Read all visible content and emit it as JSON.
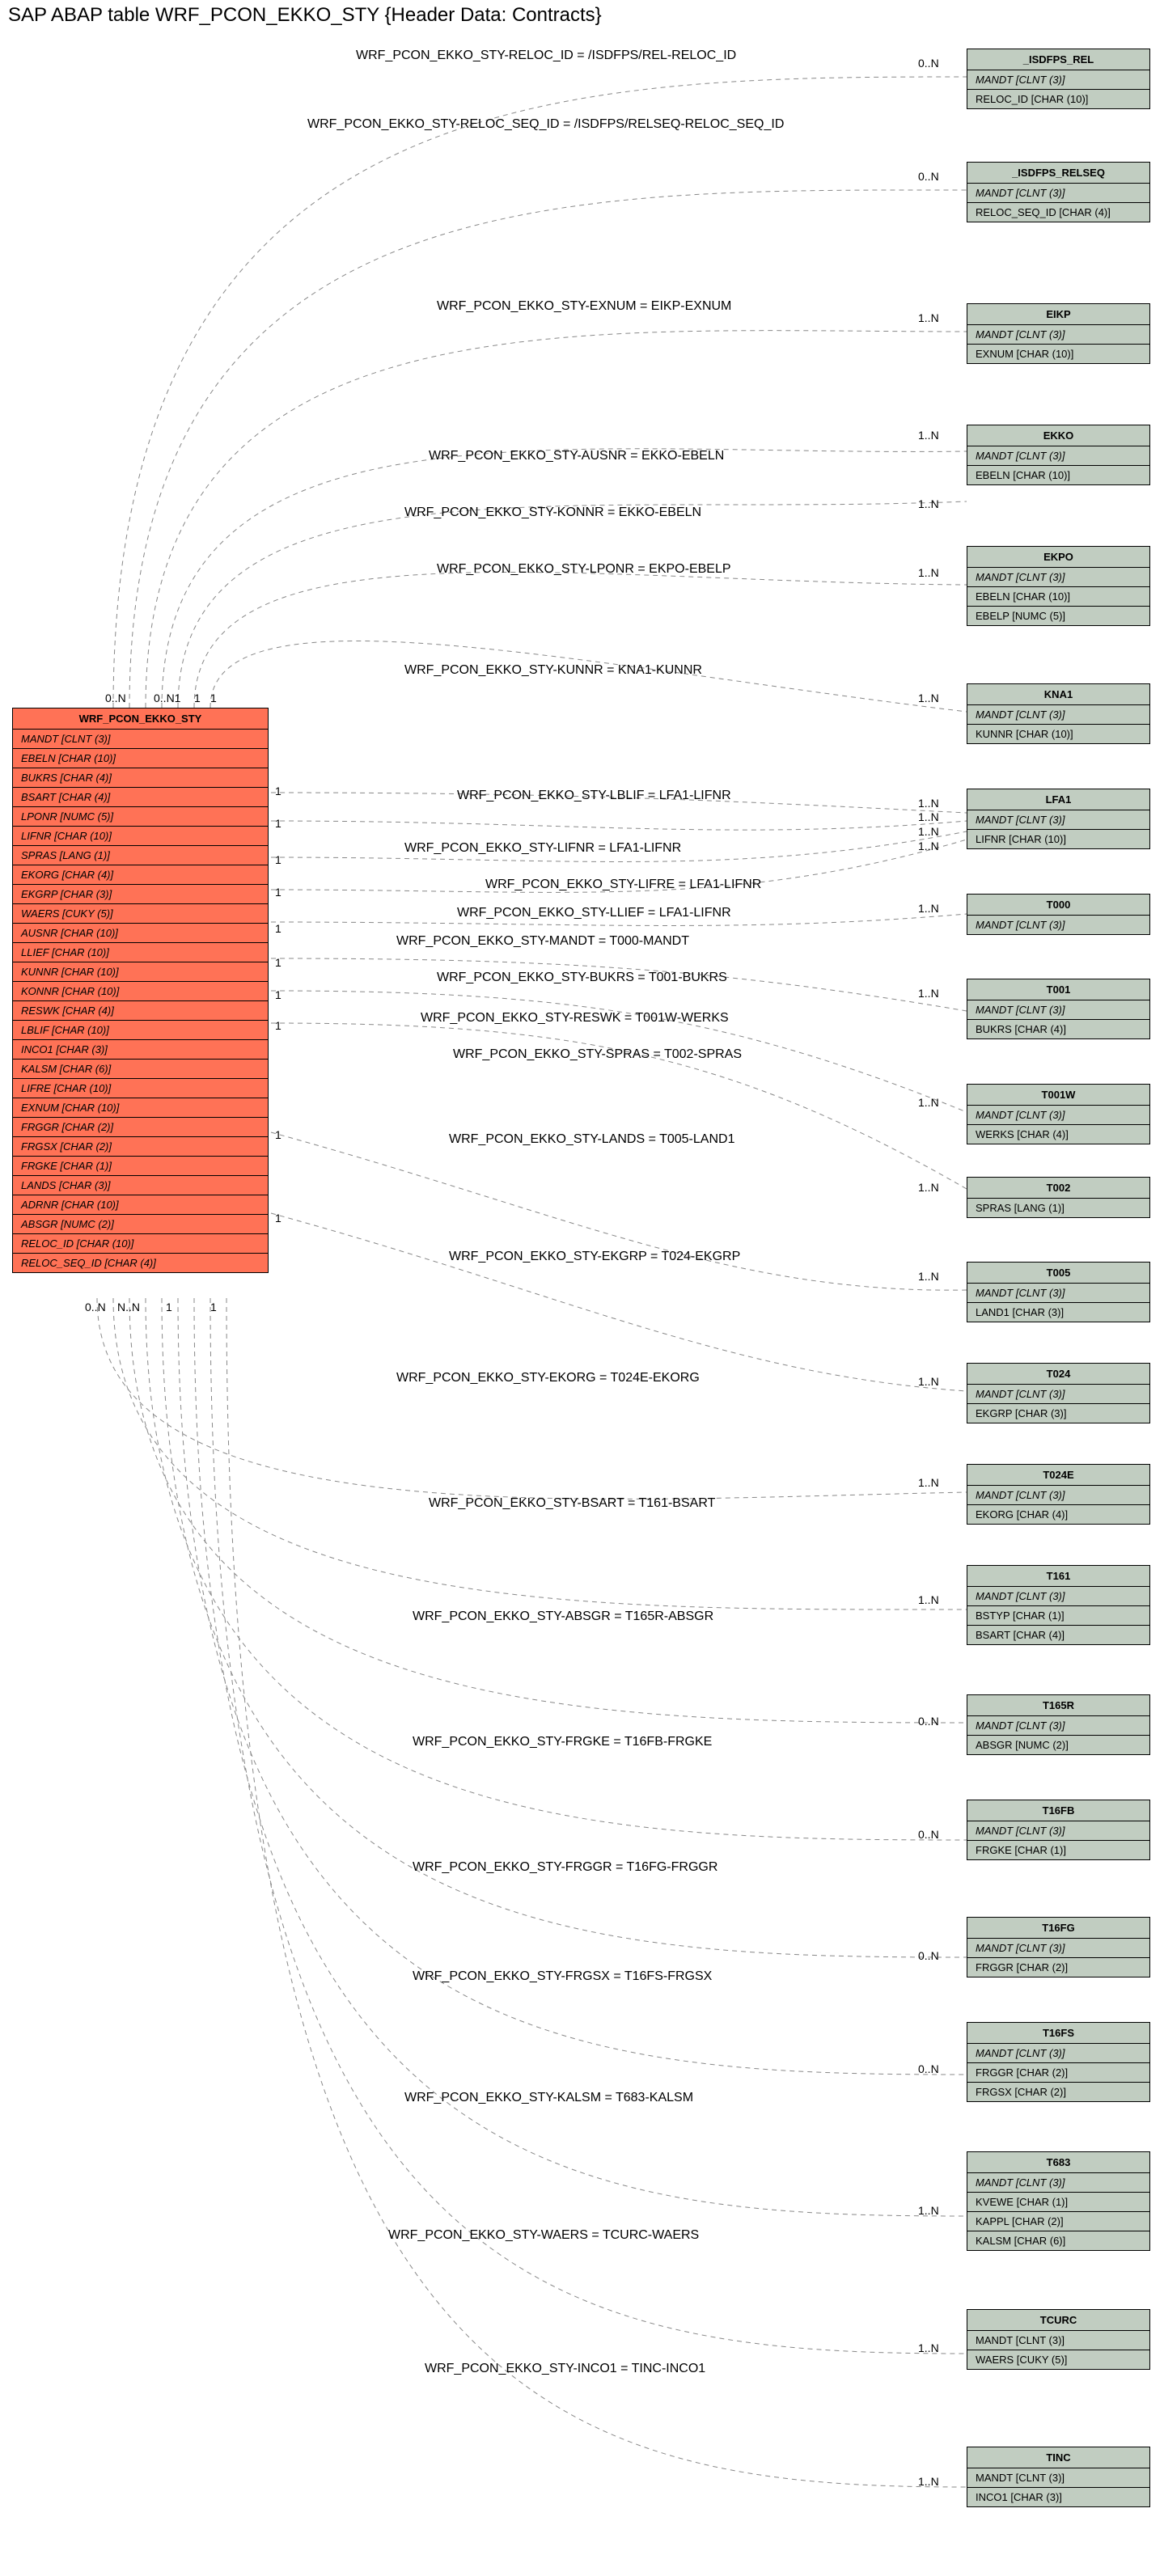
{
  "title": "SAP ABAP table WRF_PCON_EKKO_STY {Header Data: Contracts}",
  "main": {
    "name": "WRF_PCON_EKKO_STY",
    "fields": [
      "MANDT [CLNT (3)]",
      "EBELN [CHAR (10)]",
      "BUKRS [CHAR (4)]",
      "BSART [CHAR (4)]",
      "LPONR [NUMC (5)]",
      "LIFNR [CHAR (10)]",
      "SPRAS [LANG (1)]",
      "EKORG [CHAR (4)]",
      "EKGRP [CHAR (3)]",
      "WAERS [CUKY (5)]",
      "AUSNR [CHAR (10)]",
      "LLIEF [CHAR (10)]",
      "KUNNR [CHAR (10)]",
      "KONNR [CHAR (10)]",
      "RESWK [CHAR (4)]",
      "LBLIF [CHAR (10)]",
      "INCO1 [CHAR (3)]",
      "KALSM [CHAR (6)]",
      "LIFRE [CHAR (10)]",
      "EXNUM [CHAR (10)]",
      "FRGGR [CHAR (2)]",
      "FRGSX [CHAR (2)]",
      "FRGKE [CHAR (1)]",
      "LANDS [CHAR (3)]",
      "ADRNR [CHAR (10)]",
      "ABSGR [NUMC (2)]",
      "RELOC_ID [CHAR (10)]",
      "RELOC_SEQ_ID [CHAR (4)]"
    ]
  },
  "refs": [
    {
      "name": "_ISDFPS_REL",
      "fields": [
        "MANDT [CLNT (3)]",
        "RELOC_ID [CHAR (10)]"
      ],
      "noitalic": [
        1
      ]
    },
    {
      "name": "_ISDFPS_RELSEQ",
      "fields": [
        "MANDT [CLNT (3)]",
        "RELOC_SEQ_ID [CHAR (4)]"
      ],
      "noitalic": [
        1
      ]
    },
    {
      "name": "EIKP",
      "fields": [
        "MANDT [CLNT (3)]",
        "EXNUM [CHAR (10)]"
      ],
      "noitalic": [
        1
      ]
    },
    {
      "name": "EKKO",
      "fields": [
        "MANDT [CLNT (3)]",
        "EBELN [CHAR (10)]"
      ],
      "noitalic": [
        1
      ]
    },
    {
      "name": "EKPO",
      "fields": [
        "MANDT [CLNT (3)]",
        "EBELN [CHAR (10)]",
        "EBELP [NUMC (5)]"
      ],
      "noitalic": [
        1,
        2
      ]
    },
    {
      "name": "KNA1",
      "fields": [
        "MANDT [CLNT (3)]",
        "KUNNR [CHAR (10)]"
      ],
      "noitalic": [
        1
      ]
    },
    {
      "name": "LFA1",
      "fields": [
        "MANDT [CLNT (3)]",
        "LIFNR [CHAR (10)]"
      ],
      "noitalic": [
        1
      ]
    },
    {
      "name": "T000",
      "fields": [
        "MANDT [CLNT (3)]"
      ],
      "noitalic": []
    },
    {
      "name": "T001",
      "fields": [
        "MANDT [CLNT (3)]",
        "BUKRS [CHAR (4)]"
      ],
      "noitalic": [
        1
      ]
    },
    {
      "name": "T001W",
      "fields": [
        "MANDT [CLNT (3)]",
        "WERKS [CHAR (4)]"
      ],
      "noitalic": [
        1
      ]
    },
    {
      "name": "T002",
      "fields": [
        "SPRAS [LANG (1)]"
      ],
      "noitalic": [
        0
      ]
    },
    {
      "name": "T005",
      "fields": [
        "MANDT [CLNT (3)]",
        "LAND1 [CHAR (3)]"
      ],
      "noitalic": [
        1
      ]
    },
    {
      "name": "T024",
      "fields": [
        "MANDT [CLNT (3)]",
        "EKGRP [CHAR (3)]"
      ],
      "noitalic": [
        1
      ]
    },
    {
      "name": "T024E",
      "fields": [
        "MANDT [CLNT (3)]",
        "EKORG [CHAR (4)]"
      ],
      "noitalic": [
        1
      ]
    },
    {
      "name": "T161",
      "fields": [
        "MANDT [CLNT (3)]",
        "BSTYP [CHAR (1)]",
        "BSART [CHAR (4)]"
      ],
      "noitalic": [
        1,
        2
      ]
    },
    {
      "name": "T165R",
      "fields": [
        "MANDT [CLNT (3)]",
        "ABSGR [NUMC (2)]"
      ],
      "noitalic": [
        1
      ]
    },
    {
      "name": "T16FB",
      "fields": [
        "MANDT [CLNT (3)]",
        "FRGKE [CHAR (1)]"
      ],
      "noitalic": [
        1
      ]
    },
    {
      "name": "T16FG",
      "fields": [
        "MANDT [CLNT (3)]",
        "FRGGR [CHAR (2)]"
      ],
      "noitalic": [
        1
      ]
    },
    {
      "name": "T16FS",
      "fields": [
        "MANDT [CLNT (3)]",
        "FRGGR [CHAR (2)]",
        "FRGSX [CHAR (2)]"
      ],
      "noitalic": [
        1,
        2
      ]
    },
    {
      "name": "T683",
      "fields": [
        "MANDT [CLNT (3)]",
        "KVEWE [CHAR (1)]",
        "KAPPL [CHAR (2)]",
        "KALSM [CHAR (6)]"
      ],
      "noitalic": [
        1,
        2,
        3
      ]
    },
    {
      "name": "TCURC",
      "fields": [
        "MANDT [CLNT (3)]",
        "WAERS [CUKY (5)]"
      ],
      "noitalic": [
        0,
        1
      ]
    },
    {
      "name": "TINC",
      "fields": [
        "MANDT [CLNT (3)]",
        "INCO1 [CHAR (3)]"
      ],
      "noitalic": [
        0,
        1
      ]
    }
  ],
  "edges": [
    {
      "label": "WRF_PCON_EKKO_STY-RELOC_ID = /ISDFPS/REL-RELOC_ID",
      "card": "0..N"
    },
    {
      "label": "WRF_PCON_EKKO_STY-RELOC_SEQ_ID = /ISDFPS/RELSEQ-RELOC_SEQ_ID",
      "card": "0..N"
    },
    {
      "label": "WRF_PCON_EKKO_STY-EXNUM = EIKP-EXNUM",
      "card": "1..N"
    },
    {
      "label": "WRF_PCON_EKKO_STY-AUSNR = EKKO-EBELN",
      "card": "1..N"
    },
    {
      "label": "WRF_PCON_EKKO_STY-KONNR = EKKO-EBELN",
      "card": "1..N"
    },
    {
      "label": "WRF_PCON_EKKO_STY-LPONR = EKPO-EBELP",
      "card": "1..N"
    },
    {
      "label": "WRF_PCON_EKKO_STY-KUNNR = KNA1-KUNNR",
      "card": "1..N"
    },
    {
      "label": "WRF_PCON_EKKO_STY-LBLIF = LFA1-LIFNR",
      "card": "1..N"
    },
    {
      "label": "WRF_PCON_EKKO_STY-LIFNR = LFA1-LIFNR",
      "card": "1..N"
    },
    {
      "label": "WRF_PCON_EKKO_STY-LIFRE = LFA1-LIFNR",
      "card": "1..N"
    },
    {
      "label": "WRF_PCON_EKKO_STY-LLIEF = LFA1-LIFNR",
      "card": "1..N"
    },
    {
      "label": "WRF_PCON_EKKO_STY-MANDT = T000-MANDT",
      "card": "1..N"
    },
    {
      "label": "WRF_PCON_EKKO_STY-BUKRS = T001-BUKRS",
      "card": "1..N"
    },
    {
      "label": "WRF_PCON_EKKO_STY-RESWK = T001W-WERKS",
      "card": "1..N"
    },
    {
      "label": "WRF_PCON_EKKO_STY-SPRAS = T002-SPRAS",
      "card": "1..N"
    },
    {
      "label": "WRF_PCON_EKKO_STY-LANDS = T005-LAND1",
      "card": "1..N"
    },
    {
      "label": "WRF_PCON_EKKO_STY-EKGRP = T024-EKGRP",
      "card": "1..N"
    },
    {
      "label": "WRF_PCON_EKKO_STY-EKORG = T024E-EKORG",
      "card": "1..N"
    },
    {
      "label": "WRF_PCON_EKKO_STY-BSART = T161-BSART",
      "card": "1..N"
    },
    {
      "label": "WRF_PCON_EKKO_STY-ABSGR = T165R-ABSGR",
      "card": "0..N"
    },
    {
      "label": "WRF_PCON_EKKO_STY-FRGKE = T16FB-FRGKE",
      "card": "0..N"
    },
    {
      "label": "WRF_PCON_EKKO_STY-FRGGR = T16FG-FRGGR",
      "card": "0..N"
    },
    {
      "label": "WRF_PCON_EKKO_STY-FRGSX = T16FS-FRGSX",
      "card": "0..N"
    },
    {
      "label": "WRF_PCON_EKKO_STY-KALSM = T683-KALSM",
      "card": "1..N"
    },
    {
      "label": "WRF_PCON_EKKO_STY-WAERS = TCURC-WAERS",
      "card": "1..N"
    },
    {
      "label": "WRF_PCON_EKKO_STY-INCO1 = TINC-INCO1",
      "card": "1..N"
    }
  ],
  "left_cards": [
    "0..N",
    "0..N",
    "1",
    "1",
    "1",
    "1",
    "1",
    "1",
    "1",
    "1",
    "1",
    "1",
    "1"
  ],
  "bottom_cards": [
    "0..N",
    "0..N",
    "1",
    "1"
  ],
  "chart_data": {
    "type": "erd",
    "main_table": {
      "name": "WRF_PCON_EKKO_STY",
      "description": "Header Data: Contracts",
      "fields": [
        {
          "name": "MANDT",
          "type": "CLNT",
          "len": 3
        },
        {
          "name": "EBELN",
          "type": "CHAR",
          "len": 10
        },
        {
          "name": "BUKRS",
          "type": "CHAR",
          "len": 4
        },
        {
          "name": "BSART",
          "type": "CHAR",
          "len": 4
        },
        {
          "name": "LPONR",
          "type": "NUMC",
          "len": 5
        },
        {
          "name": "LIFNR",
          "type": "CHAR",
          "len": 10
        },
        {
          "name": "SPRAS",
          "type": "LANG",
          "len": 1
        },
        {
          "name": "EKORG",
          "type": "CHAR",
          "len": 4
        },
        {
          "name": "EKGRP",
          "type": "CHAR",
          "len": 3
        },
        {
          "name": "WAERS",
          "type": "CUKY",
          "len": 5
        },
        {
          "name": "AUSNR",
          "type": "CHAR",
          "len": 10
        },
        {
          "name": "LLIEF",
          "type": "CHAR",
          "len": 10
        },
        {
          "name": "KUNNR",
          "type": "CHAR",
          "len": 10
        },
        {
          "name": "KONNR",
          "type": "CHAR",
          "len": 10
        },
        {
          "name": "RESWK",
          "type": "CHAR",
          "len": 4
        },
        {
          "name": "LBLIF",
          "type": "CHAR",
          "len": 10
        },
        {
          "name": "INCO1",
          "type": "CHAR",
          "len": 3
        },
        {
          "name": "KALSM",
          "type": "CHAR",
          "len": 6
        },
        {
          "name": "LIFRE",
          "type": "CHAR",
          "len": 10
        },
        {
          "name": "EXNUM",
          "type": "CHAR",
          "len": 10
        },
        {
          "name": "FRGGR",
          "type": "CHAR",
          "len": 2
        },
        {
          "name": "FRGSX",
          "type": "CHAR",
          "len": 2
        },
        {
          "name": "FRGKE",
          "type": "CHAR",
          "len": 1
        },
        {
          "name": "LANDS",
          "type": "CHAR",
          "len": 3
        },
        {
          "name": "ADRNR",
          "type": "CHAR",
          "len": 10
        },
        {
          "name": "ABSGR",
          "type": "NUMC",
          "len": 2
        },
        {
          "name": "RELOC_ID",
          "type": "CHAR",
          "len": 10
        },
        {
          "name": "RELOC_SEQ_ID",
          "type": "CHAR",
          "len": 4
        }
      ]
    },
    "relations": [
      {
        "from_field": "RELOC_ID",
        "to_table": "/ISDFPS/REL",
        "to_field": "RELOC_ID",
        "cardinality": "0..N"
      },
      {
        "from_field": "RELOC_SEQ_ID",
        "to_table": "/ISDFPS/RELSEQ",
        "to_field": "RELOC_SEQ_ID",
        "cardinality": "0..N"
      },
      {
        "from_field": "EXNUM",
        "to_table": "EIKP",
        "to_field": "EXNUM",
        "cardinality": "1..N"
      },
      {
        "from_field": "AUSNR",
        "to_table": "EKKO",
        "to_field": "EBELN",
        "cardinality": "1..N"
      },
      {
        "from_field": "KONNR",
        "to_table": "EKKO",
        "to_field": "EBELN",
        "cardinality": "1..N"
      },
      {
        "from_field": "LPONR",
        "to_table": "EKPO",
        "to_field": "EBELP",
        "cardinality": "1..N"
      },
      {
        "from_field": "KUNNR",
        "to_table": "KNA1",
        "to_field": "KUNNR",
        "cardinality": "1..N"
      },
      {
        "from_field": "LBLIF",
        "to_table": "LFA1",
        "to_field": "LIFNR",
        "cardinality": "1..N"
      },
      {
        "from_field": "LIFNR",
        "to_table": "LFA1",
        "to_field": "LIFNR",
        "cardinality": "1..N"
      },
      {
        "from_field": "LIFRE",
        "to_table": "LFA1",
        "to_field": "LIFNR",
        "cardinality": "1..N"
      },
      {
        "from_field": "LLIEF",
        "to_table": "LFA1",
        "to_field": "LIFNR",
        "cardinality": "1..N"
      },
      {
        "from_field": "MANDT",
        "to_table": "T000",
        "to_field": "MANDT",
        "cardinality": "1..N"
      },
      {
        "from_field": "BUKRS",
        "to_table": "T001",
        "to_field": "BUKRS",
        "cardinality": "1..N"
      },
      {
        "from_field": "RESWK",
        "to_table": "T001W",
        "to_field": "WERKS",
        "cardinality": "1..N"
      },
      {
        "from_field": "SPRAS",
        "to_table": "T002",
        "to_field": "SPRAS",
        "cardinality": "1..N"
      },
      {
        "from_field": "LANDS",
        "to_table": "T005",
        "to_field": "LAND1",
        "cardinality": "1..N"
      },
      {
        "from_field": "EKGRP",
        "to_table": "T024",
        "to_field": "EKGRP",
        "cardinality": "1..N"
      },
      {
        "from_field": "EKORG",
        "to_table": "T024E",
        "to_field": "EKORG",
        "cardinality": "1..N"
      },
      {
        "from_field": "BSART",
        "to_table": "T161",
        "to_field": "BSART",
        "cardinality": "1..N"
      },
      {
        "from_field": "ABSGR",
        "to_table": "T165R",
        "to_field": "ABSGR",
        "cardinality": "0..N"
      },
      {
        "from_field": "FRGKE",
        "to_table": "T16FB",
        "to_field": "FRGKE",
        "cardinality": "0..N"
      },
      {
        "from_field": "FRGGR",
        "to_table": "T16FG",
        "to_field": "FRGGR",
        "cardinality": "0..N"
      },
      {
        "from_field": "FRGSX",
        "to_table": "T16FS",
        "to_field": "FRGSX",
        "cardinality": "0..N"
      },
      {
        "from_field": "KALSM",
        "to_table": "T683",
        "to_field": "KALSM",
        "cardinality": "1..N"
      },
      {
        "from_field": "WAERS",
        "to_table": "TCURC",
        "to_field": "WAERS",
        "cardinality": "1..N"
      },
      {
        "from_field": "INCO1",
        "to_table": "TINC",
        "to_field": "INCO1",
        "cardinality": "1..N"
      }
    ]
  }
}
